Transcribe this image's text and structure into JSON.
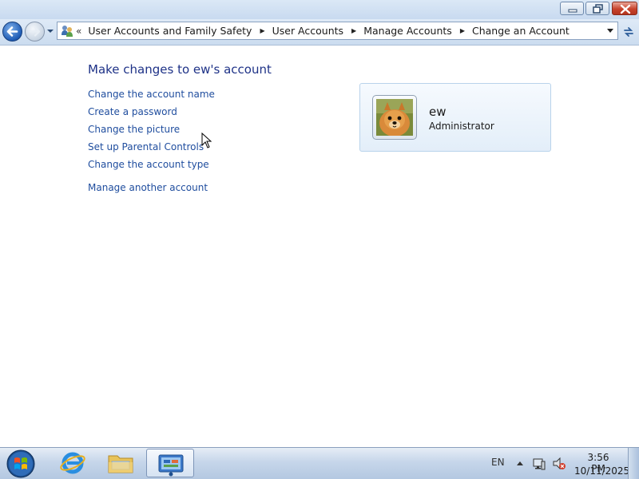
{
  "breadcrumb": {
    "items": [
      "User Accounts and Family Safety",
      "User Accounts",
      "Manage Accounts",
      "Change an Account"
    ]
  },
  "main": {
    "title": "Make changes to ew's account",
    "tasks": [
      "Change the account name",
      "Create a password",
      "Change the picture",
      "Set up Parental Controls",
      "Change the account type"
    ],
    "manage_other": "Manage another account"
  },
  "account": {
    "name": "ew",
    "role": "Administrator"
  },
  "taskbar": {
    "language": "EN",
    "time": "3:56 PM",
    "date": "10/11/2025",
    "pinned": [
      "start-orb",
      "internet-explorer-icon",
      "windows-explorer-icon",
      "control-panel-icon"
    ]
  },
  "colors": {
    "link": "#1f4d9e",
    "title": "#1e3287",
    "card_border": "#b9d3eb"
  }
}
